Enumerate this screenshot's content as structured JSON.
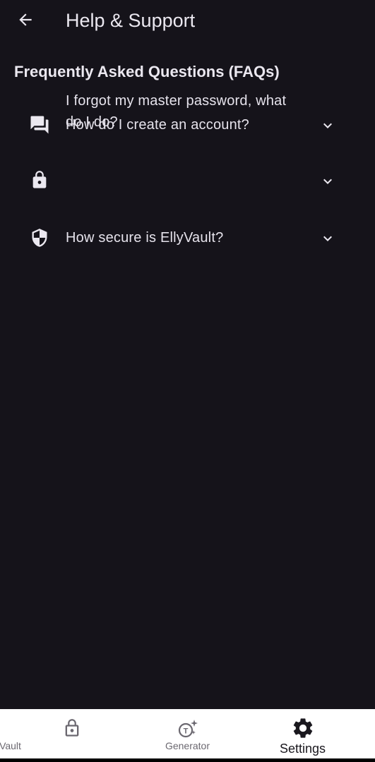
{
  "app_bar": {
    "back_icon": "arrow-back-icon",
    "title": "Help & Support"
  },
  "section": {
    "title": "Frequently Asked Questions (FAQs)"
  },
  "faqs": [
    {
      "icon": "chat-bubbles-icon",
      "question": "How do I create an account?",
      "expand_icon": "chevron-down-icon"
    },
    {
      "icon": "lock-icon",
      "question": "I forgot my master password, what do I do?",
      "expand_icon": "chevron-down-icon"
    },
    {
      "icon": "shield-icon",
      "question": "How secure is EllyVault?",
      "expand_icon": "chevron-down-icon"
    }
  ],
  "bottom_nav": {
    "items": [
      {
        "label": "Vault",
        "icon": "lock-icon",
        "selected": false
      },
      {
        "label": "Generator",
        "icon": "generator-icon",
        "selected": false
      },
      {
        "label": "Settings",
        "icon": "gear-icon",
        "selected": true
      }
    ]
  },
  "colors": {
    "background": "#15131a",
    "text": "#e9e6ee",
    "nav_background": "#ffffff",
    "nav_inactive": "#6b6870",
    "nav_active": "#1a181e"
  }
}
